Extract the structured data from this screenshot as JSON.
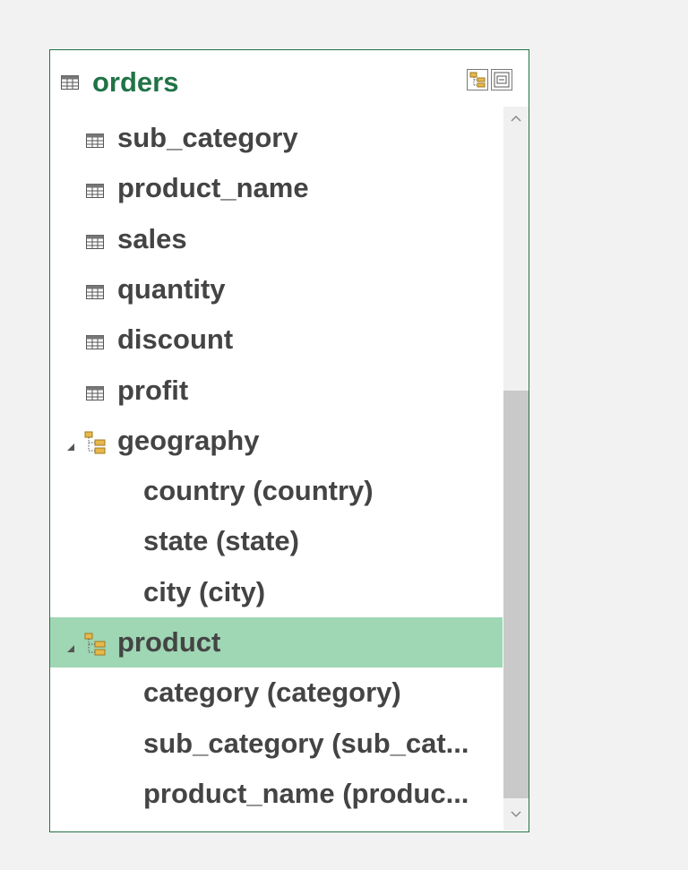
{
  "table": {
    "name": "orders",
    "icon": "table-icon",
    "header_buttons": [
      "hierarchy-view-icon",
      "collapse-view-icon"
    ]
  },
  "items": [
    {
      "type": "field",
      "label": "sub_category",
      "icon": "field-table-icon"
    },
    {
      "type": "field",
      "label": "product_name",
      "icon": "field-table-icon"
    },
    {
      "type": "field",
      "label": "sales",
      "icon": "field-table-icon"
    },
    {
      "type": "field",
      "label": "quantity",
      "icon": "field-table-icon"
    },
    {
      "type": "field",
      "label": "discount",
      "icon": "field-table-icon"
    },
    {
      "type": "field",
      "label": "profit",
      "icon": "field-table-icon"
    },
    {
      "type": "hierarchy",
      "label": "geography",
      "icon": "hierarchy-icon",
      "expanded": true
    },
    {
      "type": "level",
      "label": "country (country)"
    },
    {
      "type": "level",
      "label": "state (state)"
    },
    {
      "type": "level",
      "label": "city (city)"
    },
    {
      "type": "hierarchy",
      "label": "product",
      "icon": "hierarchy-icon",
      "expanded": true,
      "selected": true
    },
    {
      "type": "level",
      "label": "category (category)"
    },
    {
      "type": "level",
      "label": "sub_category (sub_cat..."
    },
    {
      "type": "level",
      "label": "product_name (produc..."
    }
  ],
  "colors": {
    "accent": "#217346",
    "selected_bg": "#9fd6b4",
    "text": "#444444"
  }
}
